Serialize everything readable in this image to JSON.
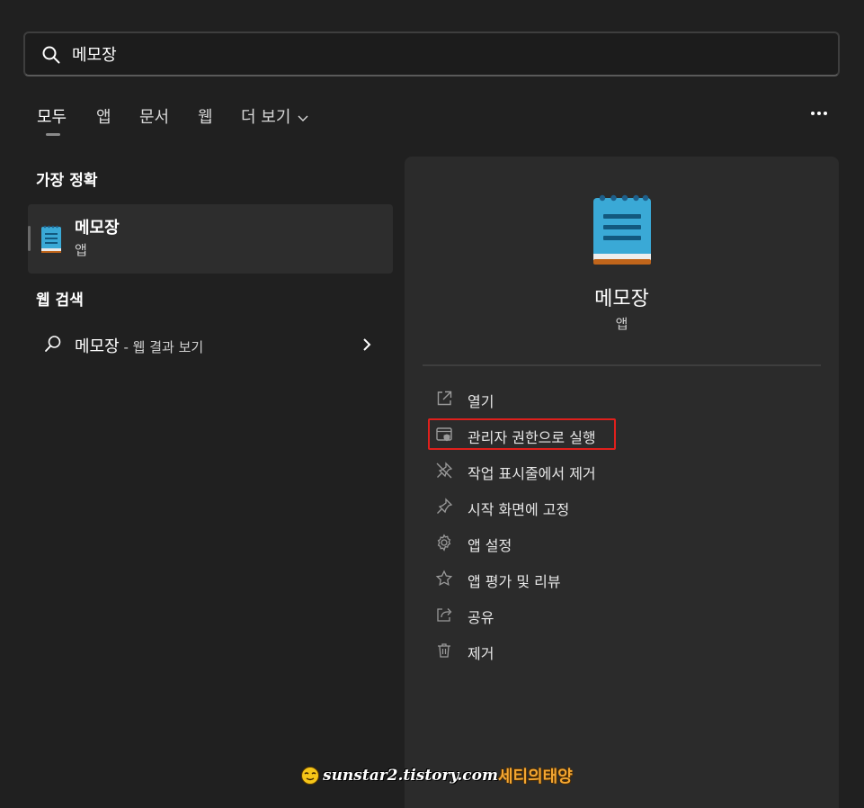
{
  "search": {
    "value": "메모장",
    "placeholder": ""
  },
  "tabs": [
    {
      "label": "모두"
    },
    {
      "label": "앱"
    },
    {
      "label": "문서"
    },
    {
      "label": "웹"
    },
    {
      "label": "더 보기"
    }
  ],
  "best_match": {
    "section_title": "가장 정확",
    "name": "메모장",
    "type": "앱"
  },
  "web_search": {
    "section_title": "웹 검색",
    "query": "메모장",
    "suffix": " - 웹 결과 보기"
  },
  "detail": {
    "name": "메모장",
    "type": "앱",
    "actions": [
      {
        "label": "열기",
        "icon": "open-icon"
      },
      {
        "label": "관리자 권한으로 실행",
        "icon": "run-as-admin-icon"
      },
      {
        "label": "작업 표시줄에서 제거",
        "icon": "unpin-icon"
      },
      {
        "label": "시작 화면에 고정",
        "icon": "pin-icon"
      },
      {
        "label": "앱 설정",
        "icon": "gear-icon"
      },
      {
        "label": "앱 평가 및 리뷰",
        "icon": "star-icon"
      },
      {
        "label": "공유",
        "icon": "share-icon"
      },
      {
        "label": "제거",
        "icon": "trash-icon"
      }
    ]
  },
  "watermark": {
    "url": "sunstar2.tistory.com",
    "name": "세티의태양"
  },
  "colors": {
    "background": "#202020",
    "pane": "#2b2b2b",
    "highlight": "#e0201c",
    "icon_blue": "#3aa9d6"
  }
}
